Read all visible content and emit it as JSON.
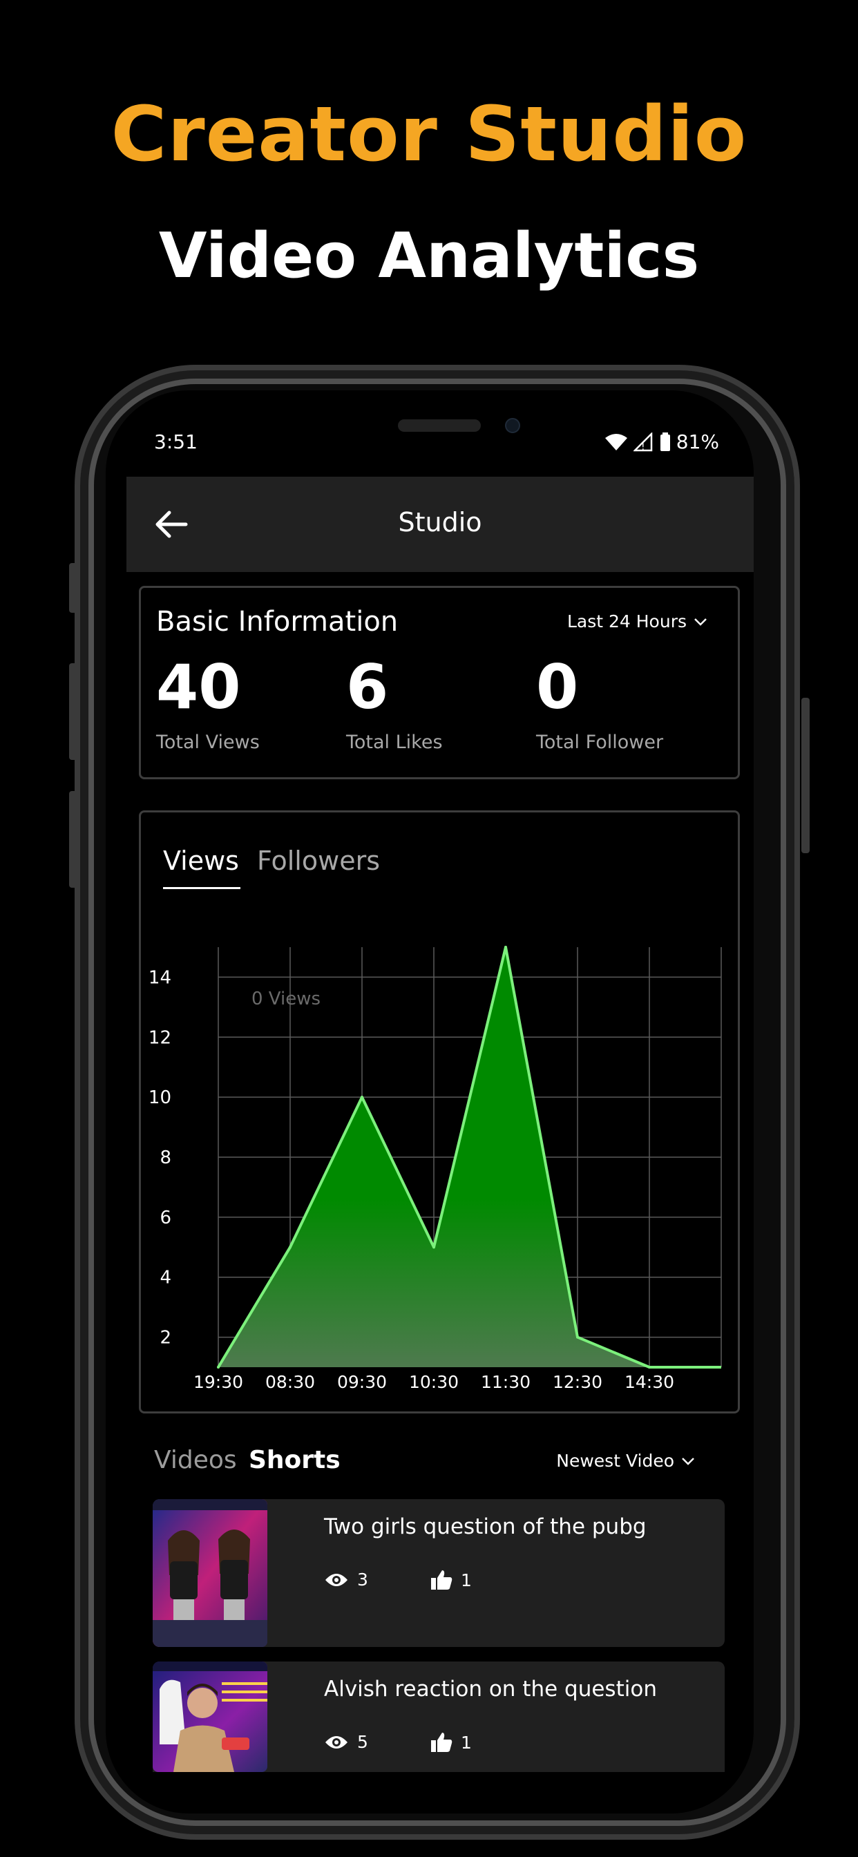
{
  "promo": {
    "title": "Creator Studio",
    "subtitle": "Video Analytics"
  },
  "status_bar": {
    "time": "3:51",
    "battery": "81%"
  },
  "app_bar": {
    "title": "Studio"
  },
  "basic_info": {
    "title": "Basic Information",
    "range": "Last 24 Hours",
    "stats": [
      {
        "value": "40",
        "label": "Total Views"
      },
      {
        "value": "6",
        "label": "Total Likes"
      },
      {
        "value": "0",
        "label": "Total Follower"
      }
    ]
  },
  "chart_tabs": {
    "active": "Views",
    "inactive": "Followers"
  },
  "chart_data": {
    "type": "area",
    "x": [
      "19:30",
      "08:30",
      "09:30",
      "10:30",
      "11:30",
      "12:30",
      "14:30"
    ],
    "values": [
      1,
      5,
      10,
      5,
      15,
      2,
      1
    ],
    "y_ticks": [
      2,
      4,
      6,
      8,
      10,
      12,
      14
    ],
    "ylim": [
      1,
      15
    ],
    "annotation": "0 Views",
    "grid": true,
    "colors": {
      "line": "#7CF07C",
      "fill_top": "#008A00",
      "fill_bottom": "#4E7A4E",
      "grid": "#5a5a5a"
    }
  },
  "list_section": {
    "tabs": [
      "Videos",
      "Shorts"
    ],
    "active_tab": "Shorts",
    "sort": "Newest Video"
  },
  "videos": [
    {
      "title": "Two girls question of the pubg",
      "views": "3",
      "likes": "1"
    },
    {
      "title": "Alvish reaction on the question",
      "views": "5",
      "likes": "1"
    }
  ],
  "colors": {
    "accent": "#F5A623",
    "background": "#000000",
    "surface": "#212121"
  }
}
